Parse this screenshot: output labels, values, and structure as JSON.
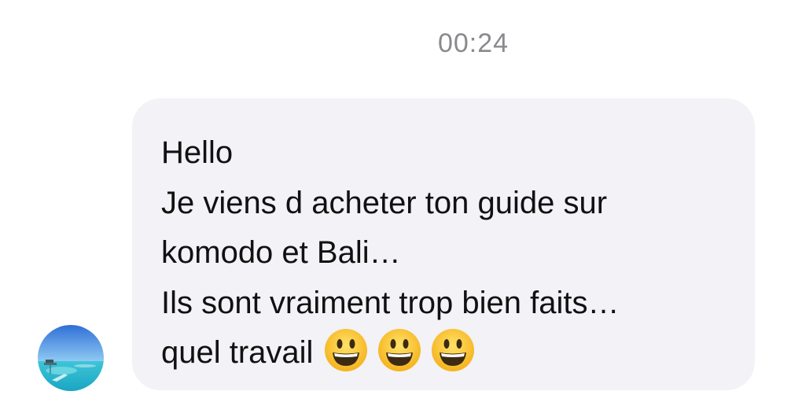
{
  "conversation": {
    "timestamp": "00:24",
    "message": {
      "lines": [
        "Hello",
        "Je viens d acheter ton guide sur",
        "komodo et Bali…",
        "Ils sont vraiment trop bien faits…",
        "quel travail"
      ],
      "trailing_emojis": [
        "grinning-face-emoji",
        "grinning-face-emoji",
        "grinning-face-emoji"
      ]
    },
    "sender_avatar_icon": "beach-photo-avatar"
  }
}
